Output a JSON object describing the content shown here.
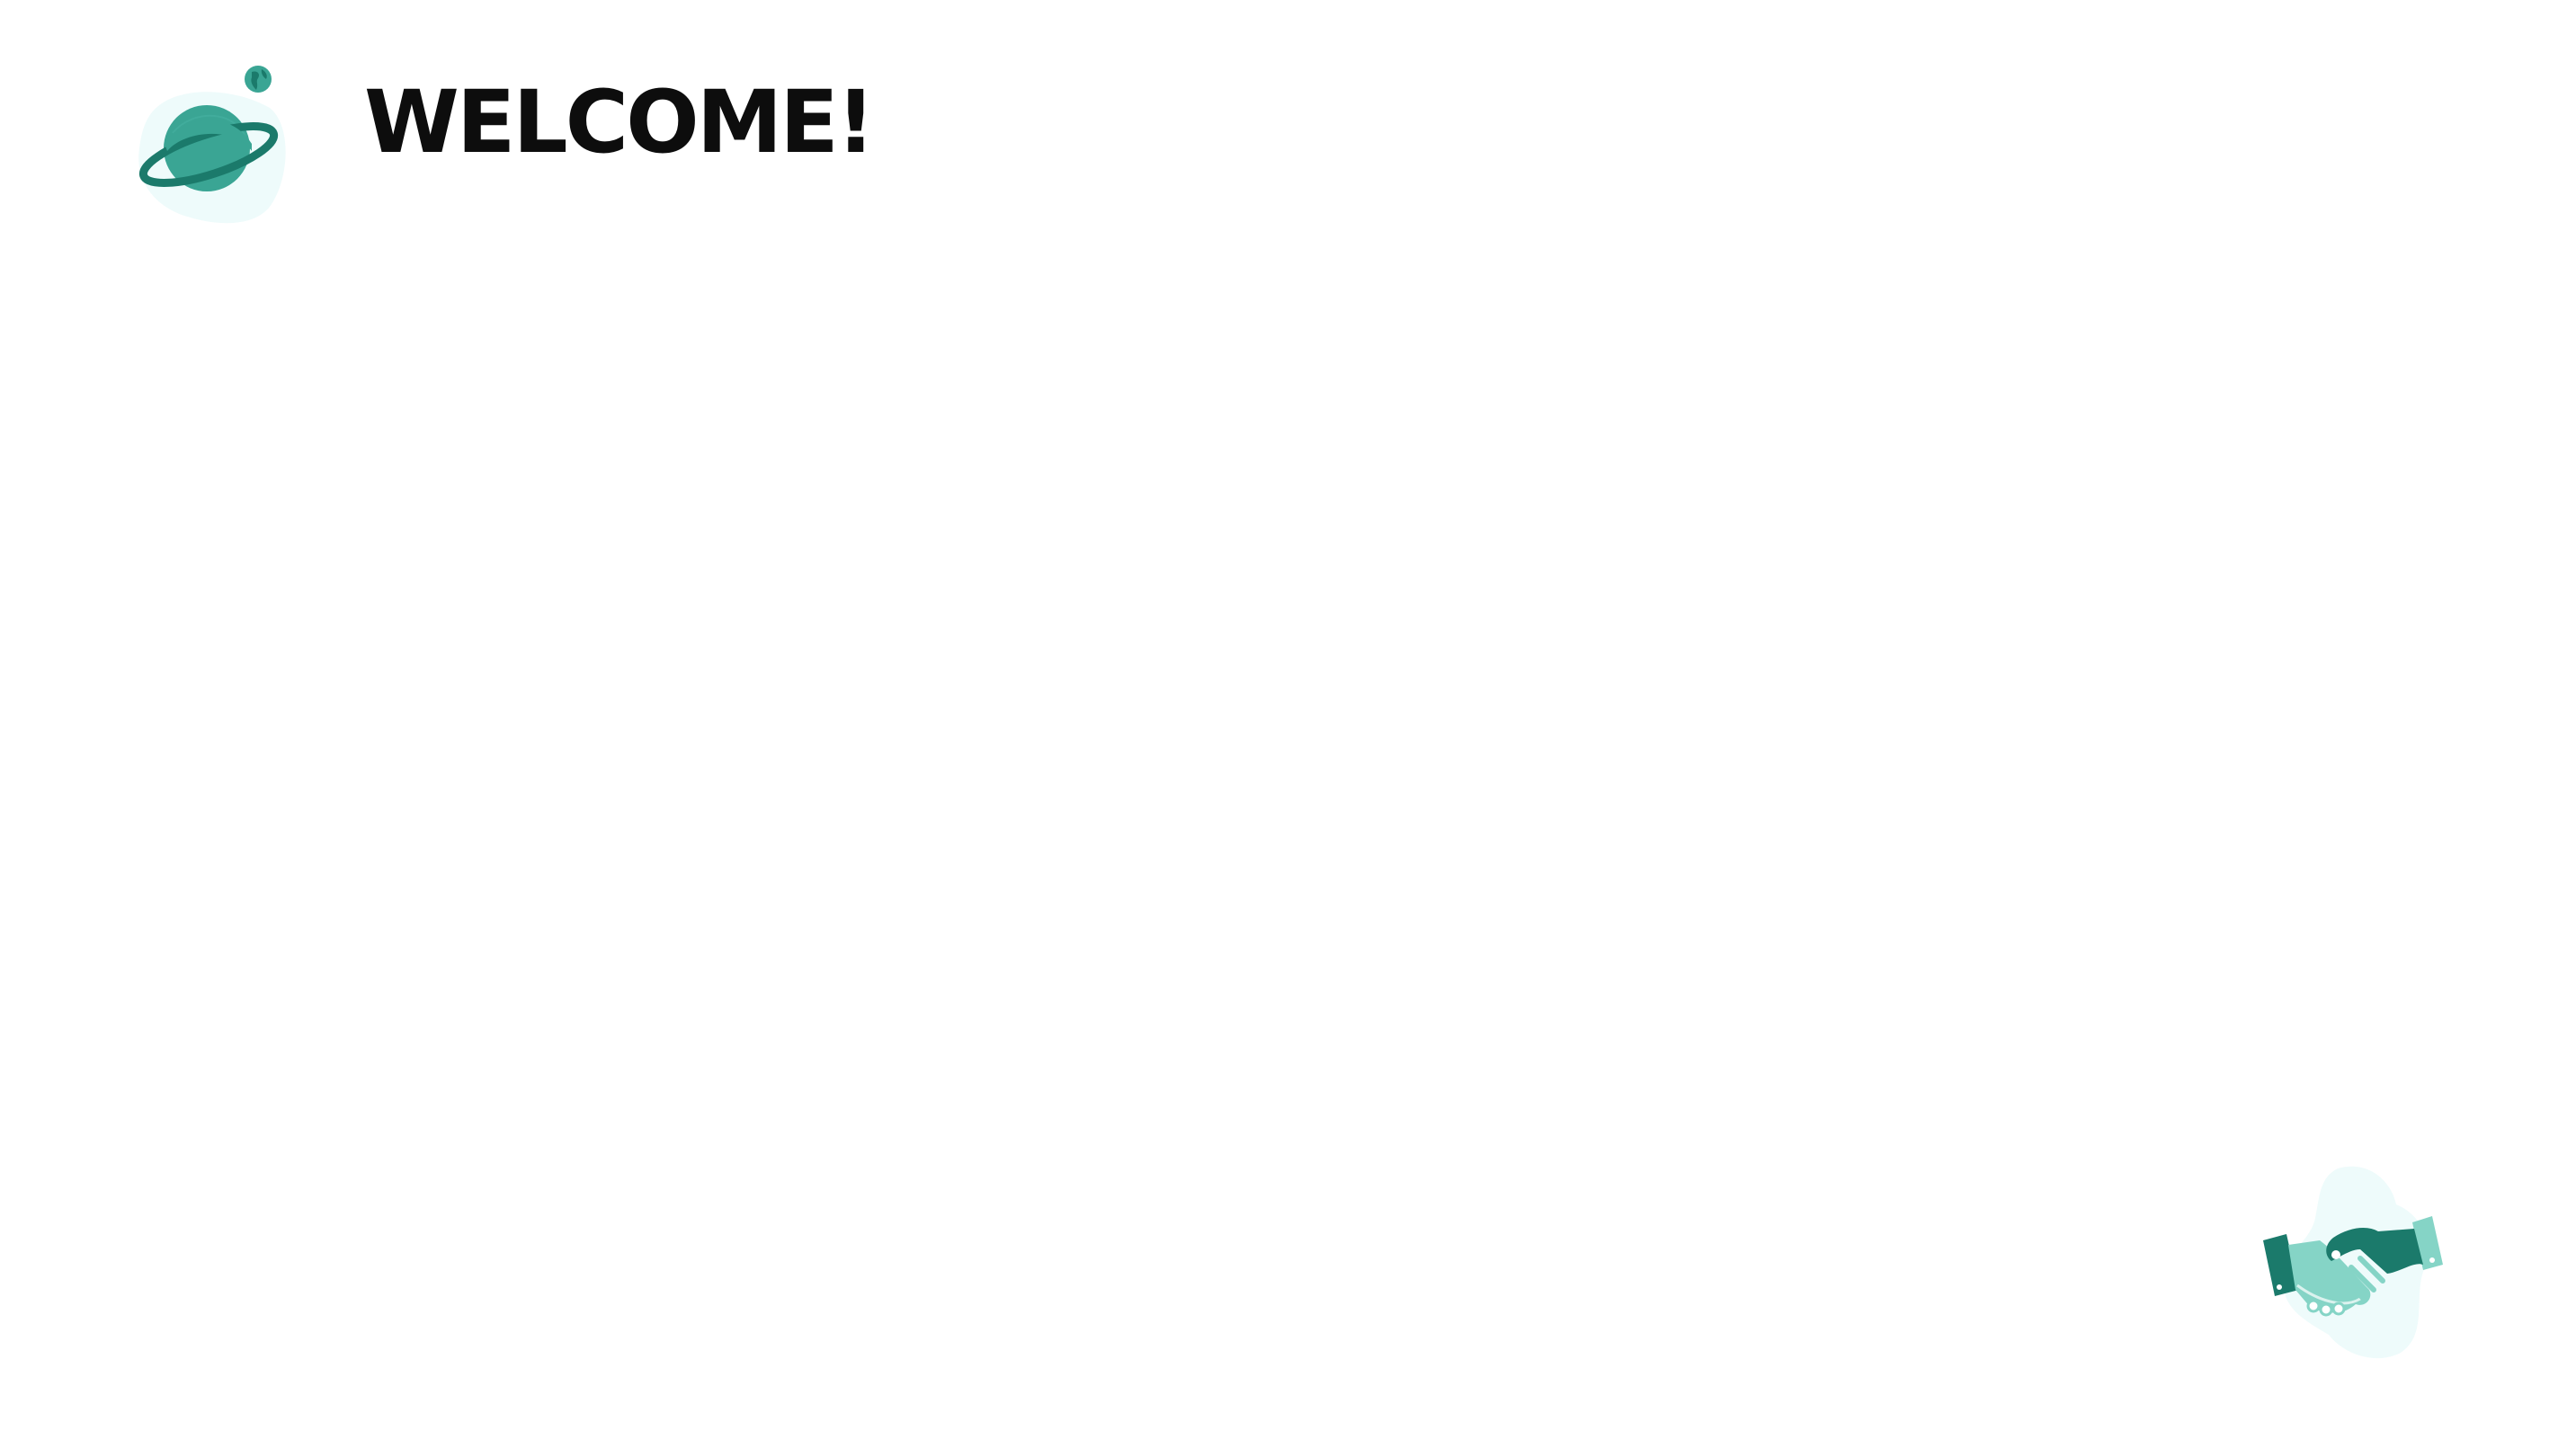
{
  "slide": {
    "title": "WELCOME!"
  },
  "icons": {
    "top_left": "planet-icon",
    "small_globe": "globe-icon",
    "bottom_right": "handshake-icon"
  },
  "colors": {
    "accent_dark": "#1b7a6b",
    "accent_mid": "#3aa594",
    "accent_light": "#85d4c6",
    "blob": "#eefbfb",
    "title": "#0d0d0d"
  }
}
